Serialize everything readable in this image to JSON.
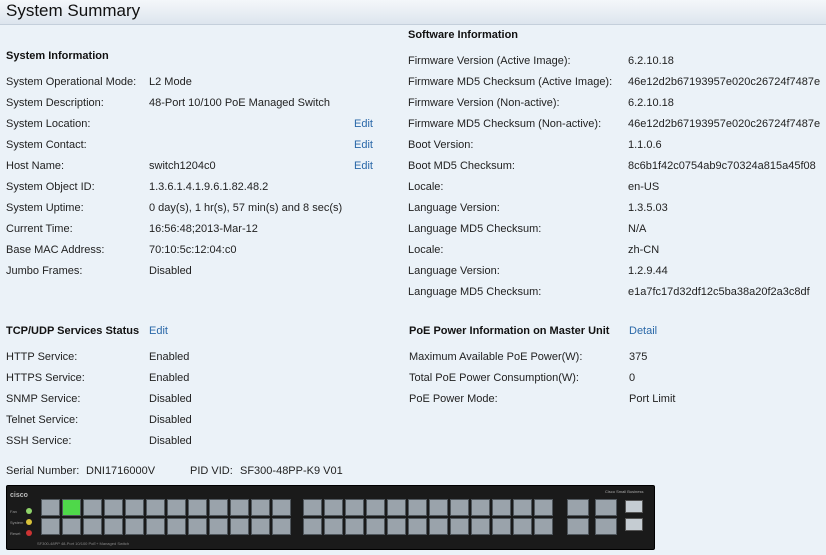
{
  "page": {
    "title": "System Summary"
  },
  "system_information": {
    "title": "System Information",
    "rows": [
      {
        "label": "System Operational Mode:",
        "value": "L2 Mode",
        "edit": ""
      },
      {
        "label": "System Description:",
        "value": "48-Port 10/100 PoE Managed Switch",
        "edit": ""
      },
      {
        "label": "System Location:",
        "value": "",
        "edit": "Edit"
      },
      {
        "label": "System Contact:",
        "value": "",
        "edit": "Edit"
      },
      {
        "label": "Host Name:",
        "value": "switch1204c0",
        "edit": "Edit"
      },
      {
        "label": "System Object ID:",
        "value": "1.3.6.1.4.1.9.6.1.82.48.2",
        "edit": ""
      },
      {
        "label": "System Uptime:",
        "value": "0 day(s), 1 hr(s), 57 min(s) and 8 sec(s)",
        "edit": ""
      },
      {
        "label": "Current Time:",
        "value": "16:56:48;2013-Mar-12",
        "edit": ""
      },
      {
        "label": "Base MAC Address:",
        "value": "70:10:5c:12:04:c0",
        "edit": ""
      },
      {
        "label": "Jumbo Frames:",
        "value": "Disabled",
        "edit": ""
      }
    ]
  },
  "software_information": {
    "title": "Software Information",
    "rows": [
      {
        "label": "Firmware Version (Active Image):",
        "value": "6.2.10.18"
      },
      {
        "label": "Firmware MD5 Checksum (Active Image):",
        "value": "46e12d2b67193957e020c26724f7487e"
      },
      {
        "label": "Firmware Version (Non-active):",
        "value": "6.2.10.18"
      },
      {
        "label": "Firmware MD5 Checksum (Non-active):",
        "value": "46e12d2b67193957e020c26724f7487e"
      },
      {
        "label": "Boot Version:",
        "value": "1.1.0.6"
      },
      {
        "label": "Boot MD5 Checksum:",
        "value": "8c6b1f42c0754ab9c70324a815a45f08"
      },
      {
        "label": "Locale:",
        "value": "en-US"
      },
      {
        "label": "Language Version:",
        "value": "1.3.5.03"
      },
      {
        "label": "Language MD5 Checksum:",
        "value": "N/A"
      },
      {
        "label": "Locale:",
        "value": "zh-CN"
      },
      {
        "label": "Language Version:",
        "value": "1.2.9.44"
      },
      {
        "label": "Language MD5 Checksum:",
        "value": "e1a7fc17d32df12c5ba38a20f2a3c8df"
      }
    ]
  },
  "tcp_udp": {
    "title": "TCP/UDP Services Status",
    "edit": "Edit",
    "rows": [
      {
        "label": "HTTP Service:",
        "value": "Enabled"
      },
      {
        "label": "HTTPS Service:",
        "value": "Enabled"
      },
      {
        "label": "SNMP Service:",
        "value": "Disabled"
      },
      {
        "label": "Telnet Service:",
        "value": "Disabled"
      },
      {
        "label": "SSH Service:",
        "value": "Disabled"
      }
    ]
  },
  "poe": {
    "title": "PoE Power Information on Master Unit",
    "detail": "Detail",
    "rows": [
      {
        "label": "Maximum Available PoE Power(W):",
        "value": "375"
      },
      {
        "label": "Total PoE Power Consumption(W):",
        "value": "0"
      },
      {
        "label": "PoE Power Mode:",
        "value": "Port Limit"
      }
    ]
  },
  "device": {
    "serial_label": "Serial Number:",
    "serial_value": "DNI1716000V",
    "pid_label": "PID VID:",
    "pid_value": "SF300-48PP-K9 V01",
    "image_model_text": "SF300-48PP 48-Port 10/100 PoE+ Managed Switch",
    "image_brand_text": "Cisco Small Business",
    "image_logo_text": "cisco",
    "led_labels": [
      "Fan",
      "System",
      "Reset"
    ],
    "lit_port_numbers": [
      3
    ]
  }
}
